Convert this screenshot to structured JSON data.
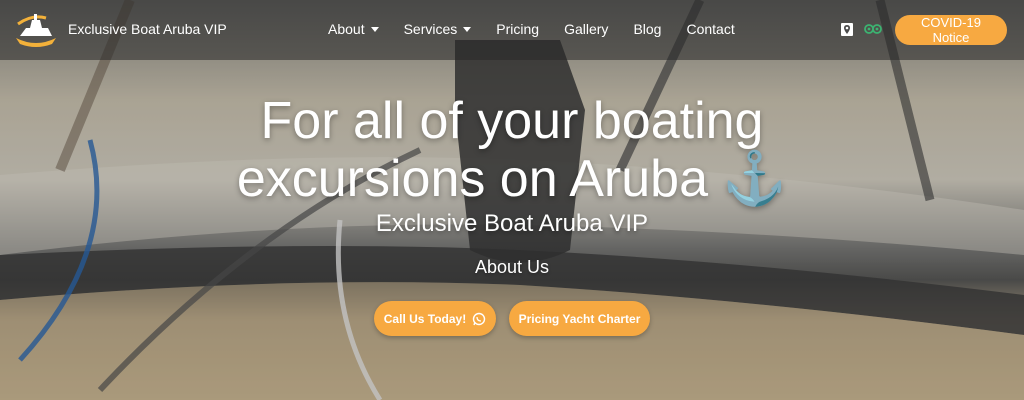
{
  "brand": {
    "name": "Exclusive Boat Aruba VIP",
    "logo": "boat-logo-icon"
  },
  "nav": [
    {
      "label": "About",
      "dropdown": true
    },
    {
      "label": "Services",
      "dropdown": true
    },
    {
      "label": "Pricing",
      "dropdown": false
    },
    {
      "label": "Gallery",
      "dropdown": false
    },
    {
      "label": "Blog",
      "dropdown": false
    },
    {
      "label": "Contact",
      "dropdown": false
    }
  ],
  "top_icons": [
    "map-pin-icon",
    "tripadvisor-icon"
  ],
  "covid_button": "COVID-19 Notice",
  "hero": {
    "headline_line1": "For all of your boating",
    "headline_line2": "excursions on Aruba ⚓",
    "subtitle": "Exclusive Boat Aruba VIP",
    "about_link": "About Us"
  },
  "buttons": {
    "call": "Call Us Today!",
    "call_icon": "whatsapp-icon",
    "pricing": "Pricing Yacht Charter"
  },
  "colors": {
    "accent": "#f7a941",
    "topbar": "rgba(40,40,40,0.55)",
    "text": "#ffffff"
  }
}
